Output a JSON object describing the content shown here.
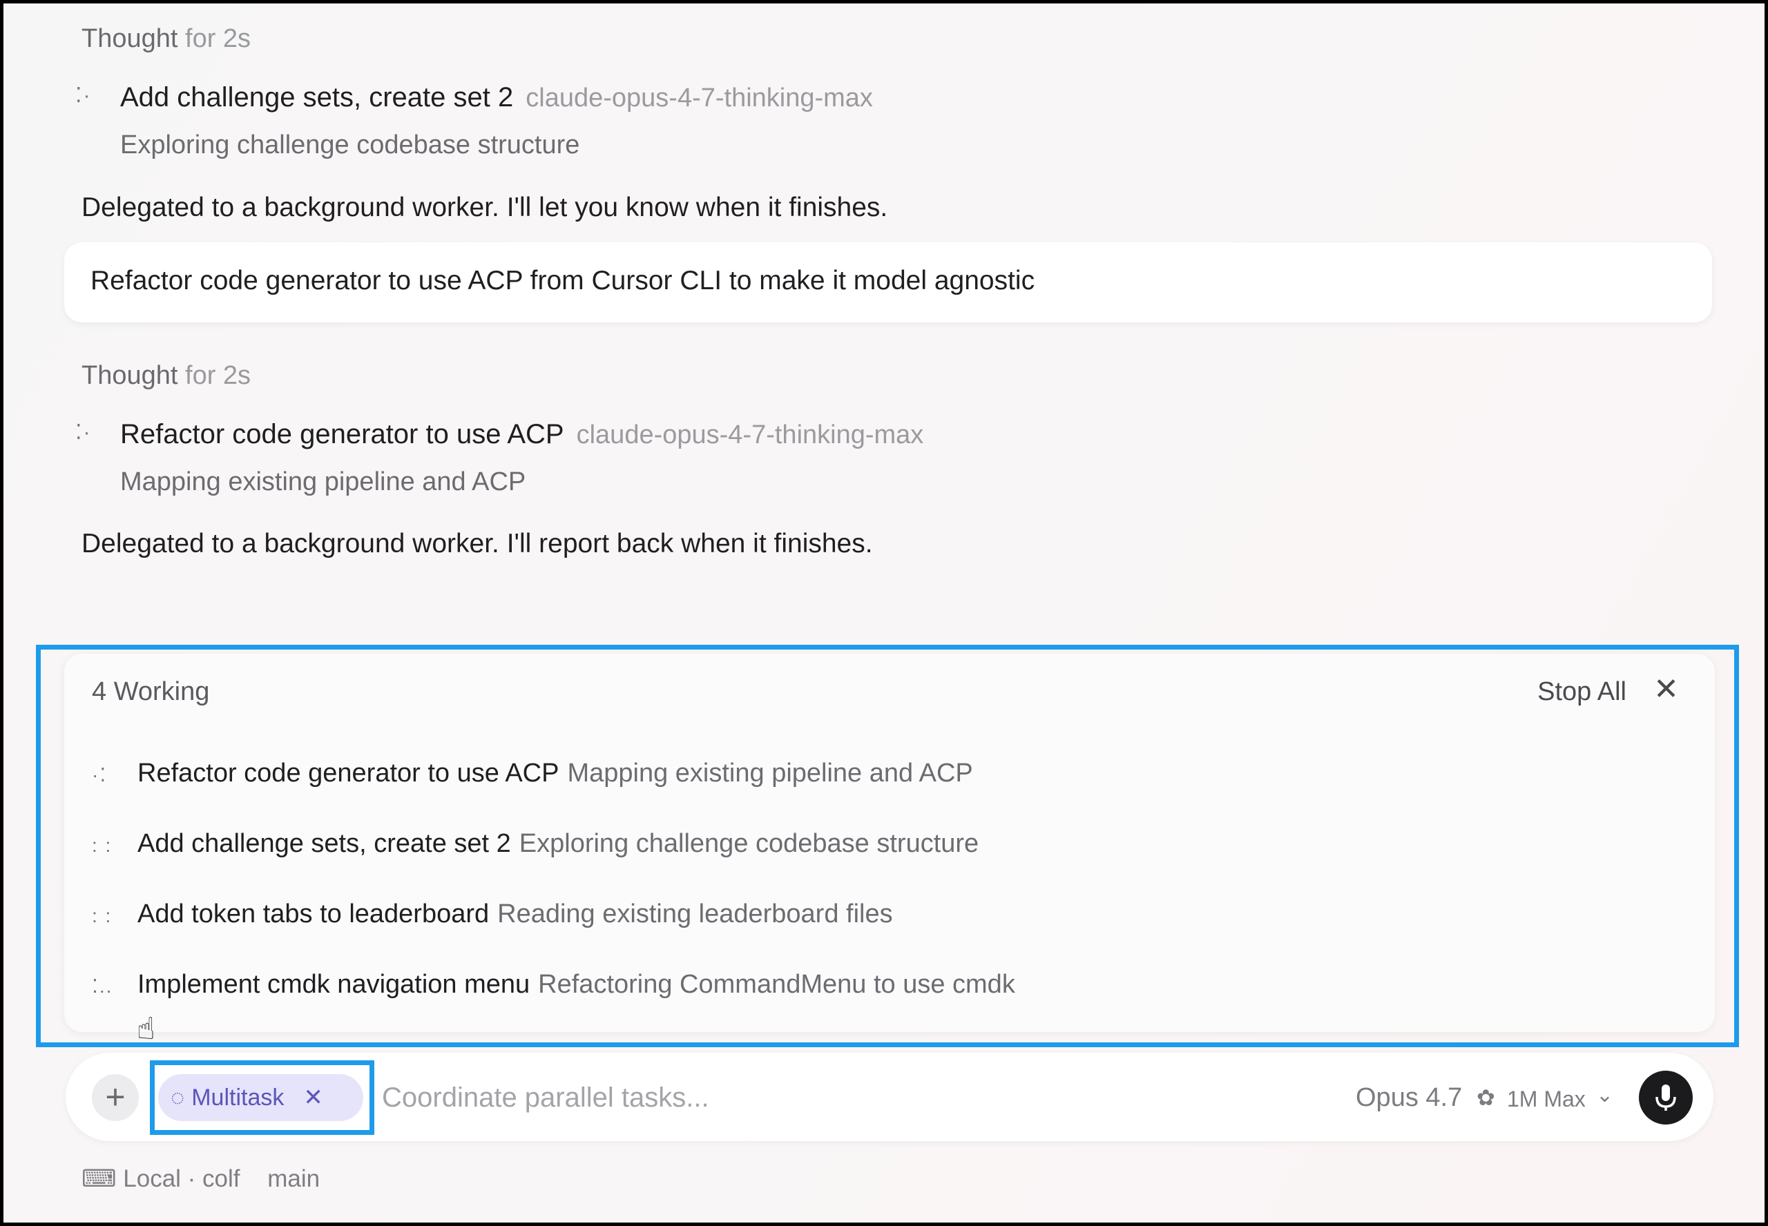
{
  "conversation": {
    "block1": {
      "thought_label": "Thought",
      "thought_duration": "for 2s",
      "task_title": "Add challenge sets, create set 2",
      "task_model": "claude-opus-4-7-thinking-max",
      "task_status": "Exploring challenge codebase structure",
      "message": "Delegated to a background worker. I'll let you know when it finishes."
    },
    "user_message": "Refactor code generator to use ACP from Cursor CLI to make it model agnostic",
    "block2": {
      "thought_label": "Thought",
      "thought_duration": "for 2s",
      "task_title": "Refactor code generator to use ACP",
      "task_model": "claude-opus-4-7-thinking-max",
      "task_status": "Mapping existing pipeline and ACP",
      "message": "Delegated to a background worker. I'll report back when it finishes."
    }
  },
  "working_panel": {
    "header": "4 Working",
    "stop_all_label": "Stop All",
    "tasks": [
      {
        "title": "Refactor code generator to use ACP",
        "status": "Mapping existing pipeline and ACP"
      },
      {
        "title": "Add challenge sets, create set 2",
        "status": "Exploring challenge codebase structure"
      },
      {
        "title": "Add token tabs to leaderboard",
        "status": "Reading existing leaderboard files"
      },
      {
        "title": "Implement cmdk navigation menu",
        "status": "Refactoring CommandMenu to use cmdk"
      }
    ]
  },
  "composer": {
    "chip_label": "Multitask",
    "placeholder": "Coordinate parallel tasks...",
    "model": "Opus 4.7",
    "context": "1M Max"
  },
  "footer": {
    "location": "Local · colf",
    "branch": "main"
  },
  "colors": {
    "highlight": "#1e9bea",
    "chip_bg": "#e6e4fa",
    "chip_text": "#5c55b8"
  },
  "icons": [
    "spinner-dots-icon",
    "close-icon",
    "plus-icon",
    "multitask-icon",
    "brain-icon",
    "chevron-down-icon",
    "microphone-icon",
    "laptop-icon",
    "pointer-cursor-icon"
  ]
}
